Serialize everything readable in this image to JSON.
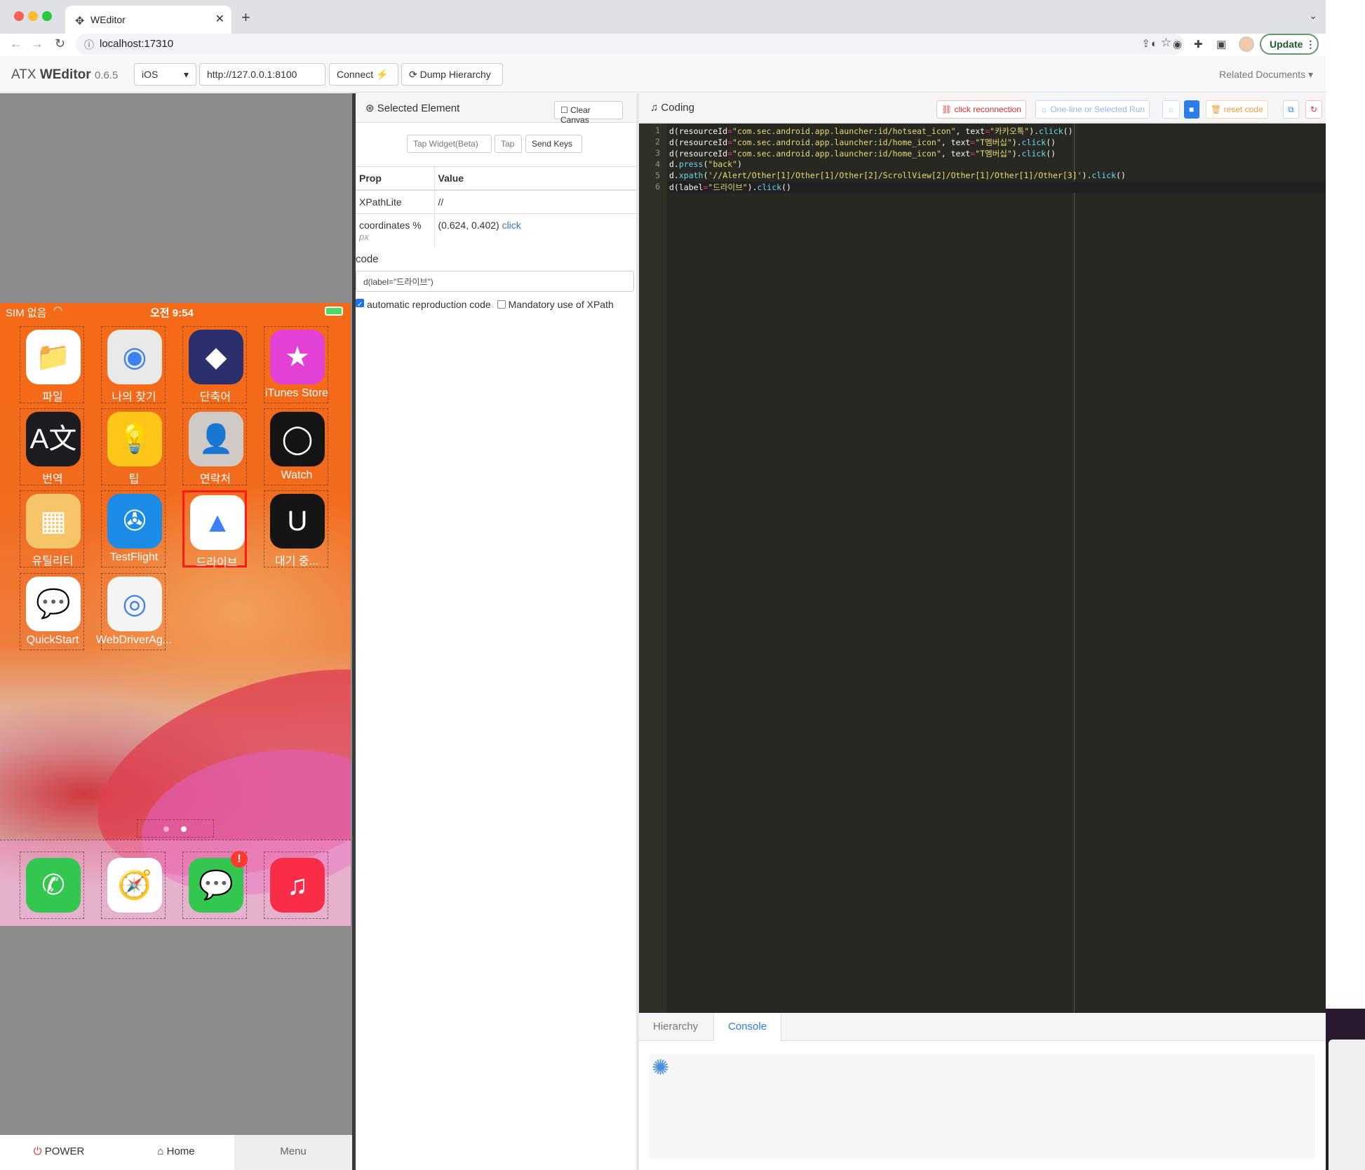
{
  "browser": {
    "tab_title": "WEditor",
    "url": "localhost:17310",
    "update_label": "Update"
  },
  "header": {
    "brand_prefix": "ATX",
    "brand_name": "WEditor",
    "version": "0.6.5",
    "platform": "iOS",
    "device_url": "http://127.0.0.1:8100",
    "connect_label": "Connect",
    "dump_label": "Dump Hierarchy",
    "related_label": "Related Documents"
  },
  "phone": {
    "carrier": "SIM 없음",
    "time": "오전 9:54",
    "apps": [
      {
        "label": "파일",
        "icon": "files-icon",
        "bg": "#ffffff",
        "glyph": "📁"
      },
      {
        "label": "나의 찾기",
        "icon": "find-my-icon",
        "bg": "#e9e9e9",
        "glyph": "◉"
      },
      {
        "label": "단축어",
        "icon": "shortcuts-icon",
        "bg": "#2b2f6b",
        "glyph": "◆"
      },
      {
        "label": "iTunes Store",
        "icon": "itunes-store-icon",
        "bg": "#e340d6",
        "glyph": "★"
      },
      {
        "label": "번역",
        "icon": "translate-icon",
        "bg": "#1c1c1e",
        "glyph": "A文"
      },
      {
        "label": "팁",
        "icon": "tips-icon",
        "bg": "#ffc61a",
        "glyph": "💡"
      },
      {
        "label": "연락처",
        "icon": "contacts-icon",
        "bg": "#cfcac6",
        "glyph": "👤"
      },
      {
        "label": "Watch",
        "icon": "watch-icon",
        "bg": "#141414",
        "glyph": "◯"
      },
      {
        "label": "유틸리티",
        "icon": "utilities-folder-icon",
        "bg": "#f6c56a",
        "glyph": "▦"
      },
      {
        "label": "TestFlight",
        "icon": "testflight-icon",
        "bg": "#1d8ce6",
        "glyph": "✇"
      },
      {
        "label": "드라이브",
        "icon": "google-drive-icon",
        "bg": "#ffffff",
        "glyph": "▲"
      },
      {
        "label": "대기 중...",
        "icon": "unreal-icon",
        "bg": "#151515",
        "glyph": "U"
      },
      {
        "label": "QuickStart",
        "icon": "quickstart-icon",
        "bg": "#ffffff",
        "glyph": "💬"
      },
      {
        "label": "WebDriverAg...",
        "icon": "webdriveragent-icon",
        "bg": "#f4f4f4",
        "glyph": "◎"
      }
    ],
    "dock": [
      {
        "icon": "phone-icon",
        "bg": "#33c74f",
        "glyph": "✆"
      },
      {
        "icon": "safari-icon",
        "bg": "#ffffff",
        "glyph": "🧭"
      },
      {
        "icon": "messages-icon",
        "bg": "#33c74f",
        "glyph": "💬",
        "badge": "!"
      },
      {
        "icon": "music-icon",
        "bg": "#fa2d48",
        "glyph": "♫"
      }
    ]
  },
  "device_buttons": {
    "power": "POWER",
    "home": "Home",
    "menu": "Menu"
  },
  "selected": {
    "title": "Selected Element",
    "clear_canvas": "Clear Canvas",
    "tap_widget": "Tap Widget(Beta)",
    "tap": "Tap",
    "send_keys": "Send Keys",
    "col_prop": "Prop",
    "col_value": "Value",
    "xpath_prop": "XPathLite",
    "xpath_value": "//",
    "coord_prop": "coordinates %",
    "coord_sub": "px",
    "coord_value": "(0.624, 0.402)",
    "coord_click": "click",
    "code_label": "code",
    "code_value": "d(label=\"드라이브\")",
    "auto_code": "automatic reproduction code",
    "auto_code_checked": true,
    "xpath_mandatory": "Mandatory use of XPath",
    "xpath_mandatory_checked": false
  },
  "coding": {
    "title": "Coding",
    "reconnect": "click reconnection",
    "run": "One-line or Selected Run",
    "reset": "reset code",
    "lines": [
      "d(resourceId=\"com.sec.android.app.launcher:id/hotseat_icon\", text=\"카카오톡\").click()",
      "d(resourceId=\"com.sec.android.app.launcher:id/home_icon\", text=\"T멤버십\").click()",
      "d(resourceId=\"com.sec.android.app.launcher:id/home_icon\", text=\"T멤버십\").click()",
      "d.press(\"back\")",
      "d.xpath('//Alert/Other[1]/Other[1]/Other[2]/ScrollView[2]/Other[1]/Other[1]/Other[3]').click()",
      "d(label=\"드라이브\").click()"
    ],
    "tab_hierarchy": "Hierarchy",
    "tab_console": "Console"
  }
}
